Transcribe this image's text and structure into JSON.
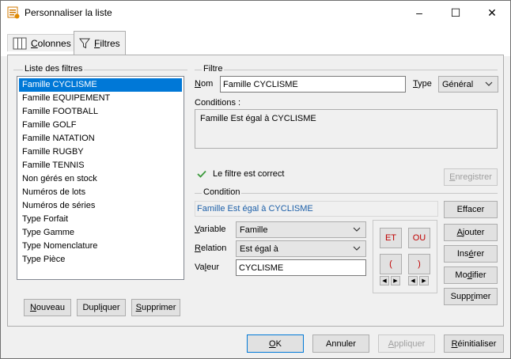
{
  "window": {
    "title": "Personnaliser la liste",
    "controls": {
      "minimize": "–",
      "maximize": "☐",
      "close": "✕"
    }
  },
  "tabs": [
    {
      "label": "Colonnes",
      "mnemonic": "C",
      "rest": "olonnes",
      "icon": "columns-icon",
      "active": false
    },
    {
      "label": "Filtres",
      "mnemonic": "F",
      "rest": "iltres",
      "icon": "filter-icon",
      "active": true
    }
  ],
  "filters_list": {
    "title": "Liste des filtres",
    "items": [
      "Famille CYCLISME",
      "Famille EQUIPEMENT",
      "Famille FOOTBALL",
      "Famille GOLF",
      "Famille NATATION",
      "Famille RUGBY",
      "Famille TENNIS",
      "Non gérés en stock",
      "Numéros de lots",
      "Numéros de séries",
      "Type Forfait",
      "Type Gamme",
      "Type Nomenclature",
      "Type Pièce"
    ],
    "selected_index": 0,
    "buttons": {
      "new_m": "N",
      "new_r": "ouveau",
      "dup_a": "Dupl",
      "dup_m": "i",
      "dup_b": "quer",
      "del_m": "S",
      "del_r": "upprimer"
    }
  },
  "filter": {
    "title": "Filtre",
    "name_label_a": "N",
    "name_label_b": "om",
    "name_value": "Famille CYCLISME",
    "type_label_a": "T",
    "type_label_b": "ype",
    "type_value": "Général",
    "conditions_label": "Conditions :",
    "conditions_text": "Famille Est égal à CYCLISME",
    "status_text": "Le filtre est correct",
    "save_m": "E",
    "save_r": "nregistrer"
  },
  "condition": {
    "title": "Condition",
    "preview": "Famille Est égal à CYCLISME",
    "variable_label_a": "V",
    "variable_label_b": "ariable",
    "variable_value": "Famille",
    "relation_label_a": "R",
    "relation_label_b": "elation",
    "relation_value": "Est égal à",
    "value_label_a": "Va",
    "value_label_b": "l",
    "value_label_c": "eur",
    "value_value": "CYCLISME",
    "ops": {
      "and": "ET",
      "or": "OU",
      "open": "(",
      "close": ")"
    },
    "tiny": {
      "left": "◀",
      "right": "▶"
    },
    "buttons": {
      "clear": "Effacer",
      "add_m": "A",
      "add_r": "jouter",
      "insert_a": "Ins",
      "insert_m": "é",
      "insert_b": "rer",
      "modify_a": "Mo",
      "modify_m": "d",
      "modify_b": "ifier",
      "delete_a": "Supp",
      "delete_m": "r",
      "delete_b": "imer"
    }
  },
  "footer": {
    "ok_m": "O",
    "ok_r": "K",
    "cancel": "Annuler",
    "apply_m": "A",
    "apply_r": "ppliquer",
    "reset_m": "R",
    "reset_r": "éinitialiser"
  },
  "colors": {
    "selection": "#0078d7",
    "check": "#3c9a3c",
    "ops_text": "#c00000",
    "preview_text": "#1c5fa8"
  }
}
